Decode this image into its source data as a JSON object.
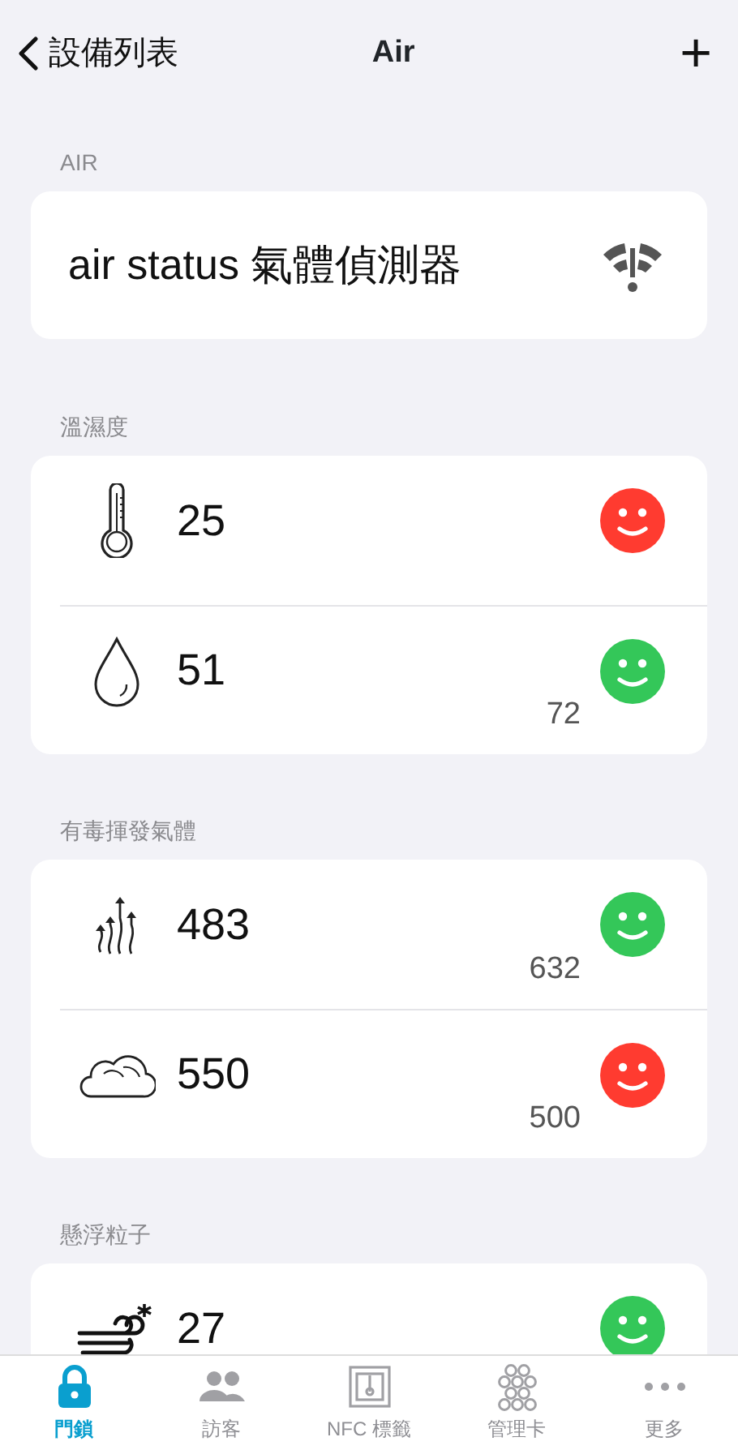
{
  "nav": {
    "back_label": "設備列表",
    "title": "Air",
    "add": "+"
  },
  "device_section": {
    "header": "AIR",
    "device_name": "air status 氣體偵測器"
  },
  "sections": [
    {
      "header": "溫濕度",
      "rows": [
        {
          "value": "25",
          "color": "#ff3b30"
        },
        {
          "value": "51",
          "reference": "72",
          "color": "#34c759"
        }
      ]
    },
    {
      "header": "有毒揮發氣體",
      "rows": [
        {
          "value": "483",
          "reference": "632",
          "color": "#34c759"
        },
        {
          "value": "550",
          "reference": "500",
          "color": "#ff3b30"
        }
      ]
    },
    {
      "header": "懸浮粒子",
      "rows": [
        {
          "value": "27",
          "color": "#34c759"
        }
      ]
    }
  ],
  "tabs": [
    {
      "label": "門鎖",
      "selected": true
    },
    {
      "label": "訪客",
      "selected": false
    },
    {
      "label": "NFC 標籤",
      "selected": false
    },
    {
      "label": "管理卡",
      "selected": false
    },
    {
      "label": "更多",
      "selected": false
    }
  ]
}
